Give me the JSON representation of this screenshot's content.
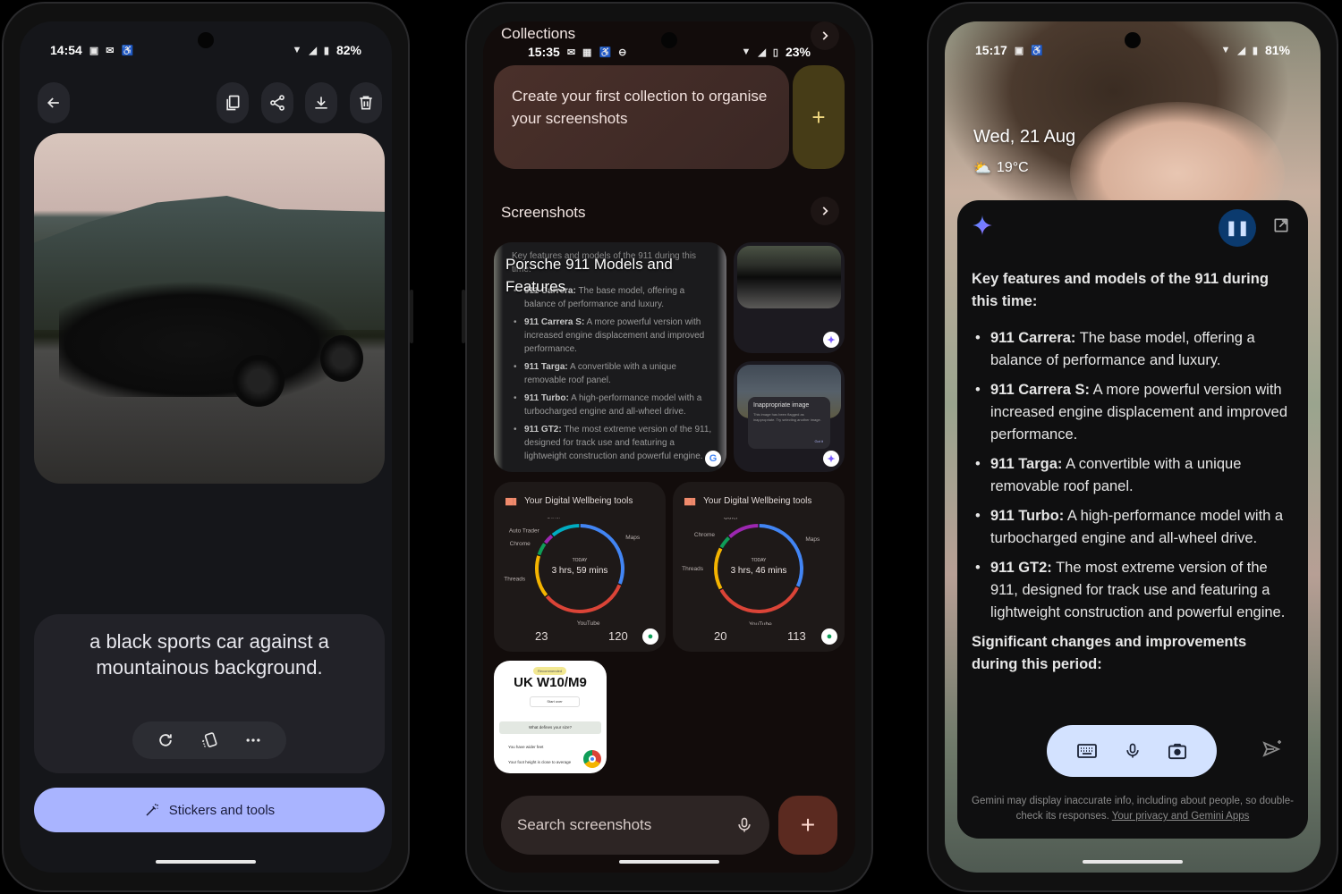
{
  "phone1": {
    "status": {
      "time": "14:54",
      "icons": [
        "teams-icon",
        "outlook-icon",
        "accessibility-icon"
      ],
      "battery": "82%"
    },
    "toolbar": {
      "back": "back",
      "actions": [
        "copy",
        "share",
        "download",
        "delete"
      ]
    },
    "photo_description": "Black Porsche 911 parked on asphalt with mountains behind",
    "caption": "a black sports car against a mountainous background.",
    "caption_actions": [
      "refresh",
      "stickers",
      "more"
    ],
    "stickers_button": "Stickers and tools",
    "colors": {
      "accent_button": "#a9b4ff"
    }
  },
  "phone2": {
    "collections_label": "Collections",
    "status": {
      "time": "15:35",
      "battery": "23%"
    },
    "create_card": "Create your first collection to organise your screenshots",
    "screenshots_label": "Screenshots",
    "porsche_tile": {
      "title": "Porsche 911 Models and Features",
      "ghost_heading": "Key features and models of the 911 during this time:",
      "items": [
        {
          "name": "911 Carrera:",
          "text": "The base model, offering a balance of performance and luxury."
        },
        {
          "name": "911 Carrera S:",
          "text": "A more powerful version with increased engine displacement and improved performance."
        },
        {
          "name": "911 Targa:",
          "text": "A convertible with a unique removable roof panel."
        },
        {
          "name": "911 Turbo:",
          "text": "A high-performance model with a turbocharged engine and all-wheel drive."
        },
        {
          "name": "911 GT2:",
          "text": "The most extreme version of the 911, designed for track use and featuring a lightweight construction and powerful engine."
        }
      ]
    },
    "inappropriate_dialog": {
      "title": "Inappropriate image",
      "body": "This image has been flagged as inappropriate. Try selecting another image.",
      "button": "Got it"
    },
    "wellbeing": [
      {
        "title": "Your Digital Wellbeing tools",
        "today_label": "TODAY",
        "total": "3 hrs, 59 mins",
        "labels": [
          "Other",
          "Auto Trader",
          "Chrome",
          "Threads",
          "YouTube",
          "Maps"
        ],
        "left_num": "23",
        "right_num": "120",
        "segments": [
          {
            "app": "Maps",
            "fraction": 0.31,
            "color": "#4285f4"
          },
          {
            "app": "YouTube",
            "fraction": 0.33,
            "color": "#db4437"
          },
          {
            "app": "Threads",
            "fraction": 0.16,
            "color": "#f4b400"
          },
          {
            "app": "Chrome",
            "fraction": 0.05,
            "color": "#0f9d58"
          },
          {
            "app": "Auto Trader",
            "fraction": 0.04,
            "color": "#9c27b0"
          },
          {
            "app": "Other",
            "fraction": 0.11,
            "color": "#00acc1"
          }
        ]
      },
      {
        "title": "Your Digital Wellbeing tools",
        "today_label": "TODAY",
        "total": "3 hrs, 46 mins",
        "labels": [
          "Other",
          "Chrome",
          "Threads",
          "YouTube",
          "Maps"
        ],
        "left_num": "20",
        "right_num": "113",
        "segments": [
          {
            "app": "Maps",
            "fraction": 0.32,
            "color": "#4285f4"
          },
          {
            "app": "YouTube",
            "fraction": 0.35,
            "color": "#db4437"
          },
          {
            "app": "Threads",
            "fraction": 0.16,
            "color": "#f4b400"
          },
          {
            "app": "Chrome",
            "fraction": 0.05,
            "color": "#0f9d58"
          },
          {
            "app": "Other",
            "fraction": 0.12,
            "color": "#9c27b0"
          }
        ]
      }
    ],
    "shoe_tile": {
      "badge": "Recommended",
      "size": "UK W10/M9",
      "start_over": "Start over",
      "question": "What defines your size?",
      "line1": "You have wider feet",
      "line2": "Your foot height is close to average"
    },
    "search": {
      "placeholder": "Search screenshots"
    },
    "fab": "+"
  },
  "phone3": {
    "status": {
      "time": "15:17",
      "battery": "81%"
    },
    "date": "Wed, 21 Aug",
    "temperature": "19°C",
    "gemini": {
      "heading1": "Key features and models of the 911 during this time:",
      "items": [
        {
          "name": "911 Carrera:",
          "text": " The base model, offering a balance of performance and luxury."
        },
        {
          "name": "911 Carrera S:",
          "text": " A more powerful version with increased engine displacement and improved performance."
        },
        {
          "name": "911 Targa:",
          "text": " A convertible with a unique removable roof panel."
        },
        {
          "name": "911 Turbo:",
          "text": " A high-performance model with a turbocharged engine and all-wheel drive."
        },
        {
          "name": "911 GT2:",
          "text": " The most extreme version of the 911, designed for track use and featuring a lightweight construction and powerful engine."
        }
      ],
      "heading2": "Significant changes and improvements during this period:",
      "disclaimer": "Gemini may display inaccurate info, including about people, so double-check its responses.",
      "privacy_link": "Your privacy and Gemini Apps"
    }
  }
}
